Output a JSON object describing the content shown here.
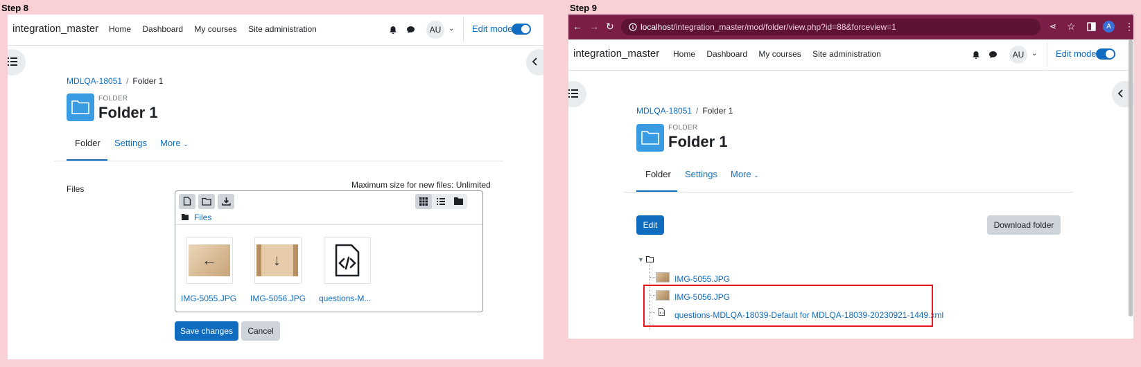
{
  "steps": {
    "step8_label": "Step 8",
    "step9_label": "Step 9"
  },
  "nav": {
    "site_name": "integration_master",
    "links": [
      "Home",
      "Dashboard",
      "My courses",
      "Site administration"
    ],
    "avatar": "AU",
    "edit_mode": "Edit mode"
  },
  "page": {
    "breadcrumb_course": "MDLQA-18051",
    "breadcrumb_sep": "/",
    "breadcrumb_current": "Folder 1",
    "pretitle": "FOLDER",
    "title": "Folder 1",
    "tabs": [
      "Folder",
      "Settings",
      "More"
    ]
  },
  "step8": {
    "files_label": "Files",
    "max_size": "Maximum size for new files: Unlimited",
    "path_label": "Files",
    "files": [
      "IMG-5055.JPG",
      "IMG-5056.JPG",
      "questions-M..."
    ],
    "save_button": "Save changes",
    "cancel_button": "Cancel"
  },
  "step9": {
    "url_host": "localhost",
    "url_path": "/integration_master/mod/folder/view.php?id=88&forceview=1",
    "profile_initial": "A",
    "edit_button": "Edit",
    "download_button": "Download folder",
    "tree_files": [
      "IMG-5055.JPG",
      "IMG-5056.JPG",
      "questions-MDLQA-18039-Default for MDLQA-18039-20230921-1449.xml"
    ]
  },
  "colors": {
    "brand_blue": "#0f6cbf",
    "folder_icon": "#399be2",
    "browser_frame": "#7a1e48",
    "highlight_red": "#e8141e",
    "page_background": "#f8d0d6"
  }
}
